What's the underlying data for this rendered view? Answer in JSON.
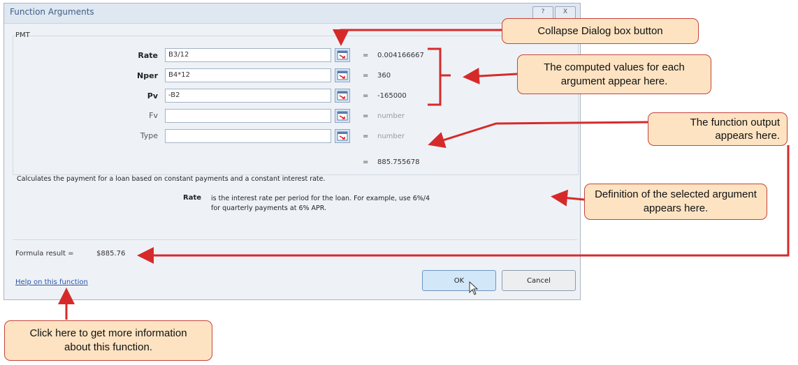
{
  "dialog": {
    "title": "Function Arguments",
    "window_buttons": [
      "?",
      "X"
    ],
    "function_name": "PMT",
    "args": [
      {
        "label": "Rate",
        "value": "B3/12",
        "result": "0.004166667",
        "bold": true
      },
      {
        "label": "Nper",
        "value": "B4*12",
        "result": "360",
        "bold": true
      },
      {
        "label": "Pv",
        "value": "-B2",
        "result": "-165000",
        "bold": true
      },
      {
        "label": "Fv",
        "value": "",
        "result": "number",
        "bold": false
      },
      {
        "label": "Type",
        "value": "",
        "result": "number",
        "bold": false
      }
    ],
    "equals": "=",
    "function_output": "885.755678",
    "description": "Calculates the payment for a loan based on constant payments and a constant interest rate.",
    "arg_help_name": "Rate",
    "arg_help_text": "is the interest rate per period for the loan. For example, use 6%/4 for quarterly payments at 6% APR.",
    "formula_result_label": "Formula result =",
    "formula_result_value": "$885.76",
    "help_link": "Help on this function",
    "ok_label": "OK",
    "cancel_label": "Cancel"
  },
  "callouts": {
    "collapse": "Collapse Dialog box button",
    "computed": "The computed values for each argument appear here.",
    "output": "The function output appears here.",
    "definition": "Definition of the selected argument appears here.",
    "help": "Click here to get more information about this function."
  },
  "colors": {
    "callout_fill": "#fde3c2",
    "callout_border": "#c6433a",
    "arrow": "#d62a2a",
    "link": "#2b55a8"
  }
}
